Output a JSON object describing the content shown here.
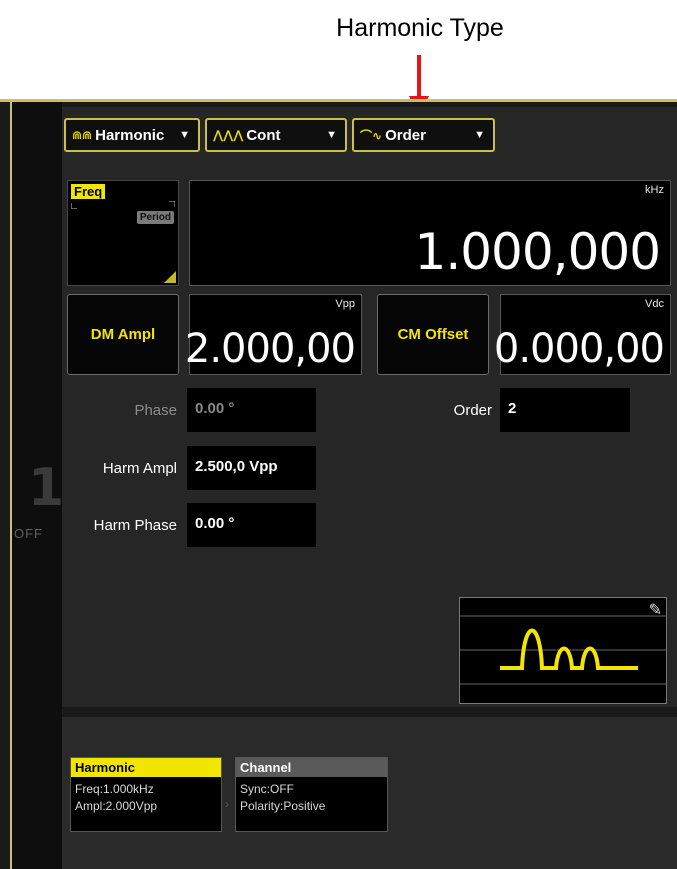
{
  "annotation": {
    "title": "Harmonic Type"
  },
  "channel": {
    "number": "1",
    "state": "OFF"
  },
  "toolbar": {
    "waveform_label": "Harmonic",
    "mode_label": "Cont",
    "type_label": "Order"
  },
  "freq": {
    "key_label": "Freq",
    "alt_label": "Period",
    "unit": "kHz",
    "value": "1.000,000"
  },
  "dm_ampl": {
    "key_label": "DM Ampl",
    "unit": "Vpp",
    "value": "2.000,00"
  },
  "cm_offset": {
    "key_label": "CM Offset",
    "unit": "Vdc",
    "value": "0.000,00"
  },
  "params": {
    "phase": {
      "label": "Phase",
      "value": "0.00 °"
    },
    "order": {
      "label": "Order",
      "value": "2"
    },
    "harm_ampl": {
      "label": "Harm Ampl",
      "value": "2.500,0 Vpp"
    },
    "harm_phase": {
      "label": "Harm Phase",
      "value": "0.00 °"
    }
  },
  "status_cards": {
    "harmonic": {
      "title": "Harmonic",
      "line1": "Freq:1.000kHz",
      "line2": "Ampl:2.000Vpp"
    },
    "channel": {
      "title": "Channel",
      "line1": "Sync:OFF",
      "line2": "Polarity:Positive"
    }
  },
  "colors": {
    "accent_yellow": "#f2e600",
    "annotation_red": "#e8141b",
    "panel_bg": "#262626"
  },
  "icons": {
    "waveform_icons": [
      "harmonic-wave-icon",
      "burst-wave-icon",
      "order-wave-icon"
    ],
    "edit": "edit-icon"
  }
}
